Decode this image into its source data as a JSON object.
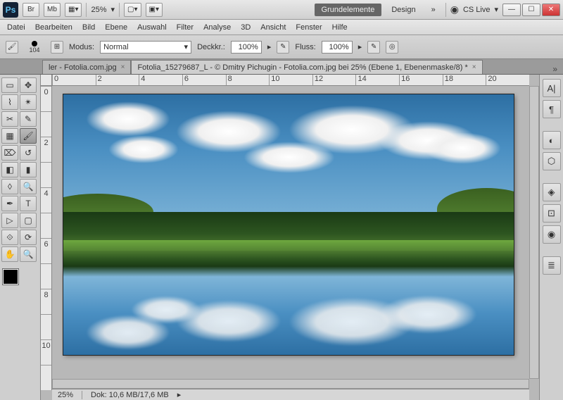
{
  "app": {
    "ps": "Ps",
    "br": "Br",
    "mb": "Mb",
    "zoom": "25%"
  },
  "workspace": {
    "active": "Grundelemente",
    "other": "Design",
    "more": "»",
    "cslive": "CS Live"
  },
  "menu": [
    "Datei",
    "Bearbeiten",
    "Bild",
    "Ebene",
    "Auswahl",
    "Filter",
    "Analyse",
    "3D",
    "Ansicht",
    "Fenster",
    "Hilfe"
  ],
  "options": {
    "brush_size": "104",
    "mode_label": "Modus:",
    "mode_value": "Normal",
    "opacity_label": "Deckkr.:",
    "opacity_value": "100%",
    "flow_label": "Fluss:",
    "flow_value": "100%"
  },
  "tabs": {
    "tab1": "ler - Fotolia.com.jpg",
    "tab2": "Fotolia_15279687_L - © Dmitry Pichugin - Fotolia.com.jpg bei 25% (Ebene 1, Ebenenmaske/8) *",
    "close": "×",
    "more": "»"
  },
  "ruler_h": [
    "0",
    "2",
    "4",
    "6",
    "8",
    "10",
    "12",
    "14",
    "16",
    "18",
    "20"
  ],
  "ruler_v": [
    "0",
    "",
    "2",
    "",
    "4",
    "",
    "6",
    "",
    "8",
    "",
    "10",
    ""
  ],
  "status": {
    "zoom": "25%",
    "doc": "Dok: 10,6 MB/17,6 MB"
  }
}
